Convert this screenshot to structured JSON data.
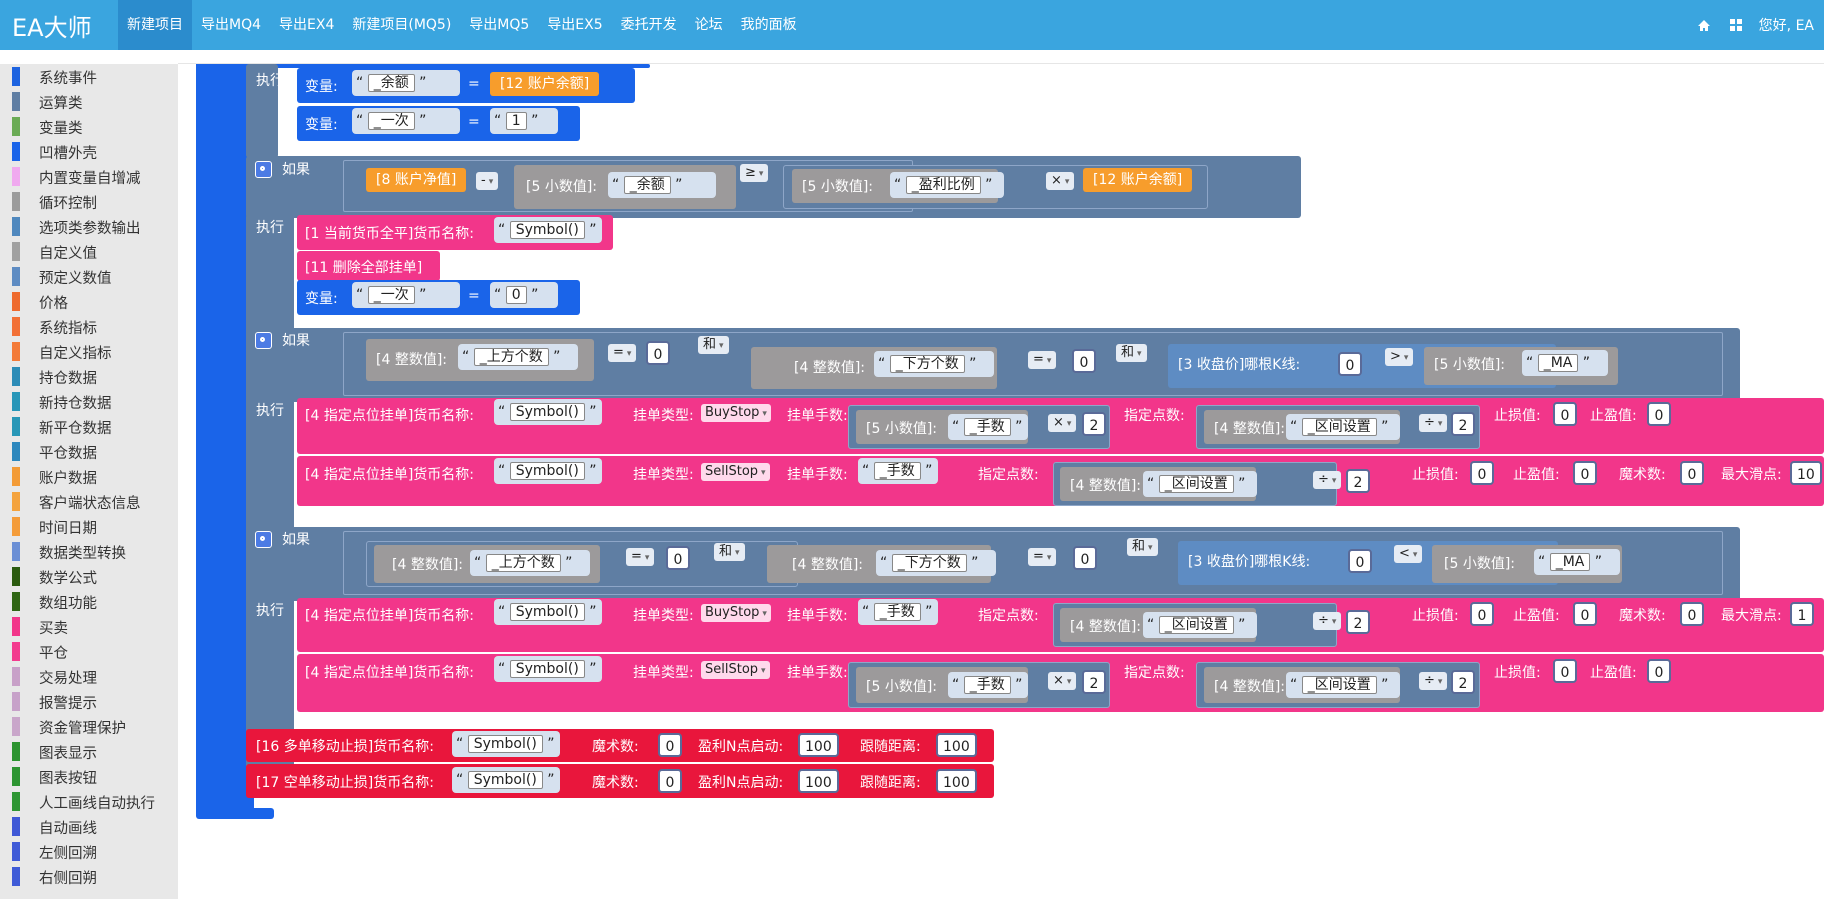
{
  "header": {
    "brand": "EA大师",
    "nav": [
      {
        "label": "新建项目",
        "active": true
      },
      {
        "label": "导出MQ4"
      },
      {
        "label": "导出EX4"
      },
      {
        "label": "新建项目(MQ5)"
      },
      {
        "label": "导出MQ5"
      },
      {
        "label": "导出EX5"
      },
      {
        "label": "委托开发"
      },
      {
        "label": "论坛"
      },
      {
        "label": "我的面板"
      }
    ],
    "greeting": "您好, EA"
  },
  "sidebar": {
    "categories": [
      {
        "label": "系统事件",
        "color": "#1d63e0"
      },
      {
        "label": "运算类",
        "color": "#5f7ea3"
      },
      {
        "label": "变量类",
        "color": "#6aab55"
      },
      {
        "label": "凹槽外壳",
        "color": "#1a64e9"
      },
      {
        "label": "内置变量自增减",
        "color": "#f0a9ef"
      },
      {
        "label": "循环控制",
        "color": "#9b9b9b"
      },
      {
        "label": "选项类参数输出",
        "color": "#4f88be"
      },
      {
        "label": "自定义值",
        "color": "#a0a0a0"
      },
      {
        "label": "预定义数值",
        "color": "#5e8cc3"
      },
      {
        "label": "价格",
        "color": "#ee6a2e"
      },
      {
        "label": "系统指标",
        "color": "#f27036"
      },
      {
        "label": "自定义指标",
        "color": "#f37a38"
      },
      {
        "label": "持仓数据",
        "color": "#2c8cb7"
      },
      {
        "label": "新持仓数据",
        "color": "#2796b8"
      },
      {
        "label": "新平仓数据",
        "color": "#2897b7"
      },
      {
        "label": "平仓数据",
        "color": "#2c87bd"
      },
      {
        "label": "账户数据",
        "color": "#f39b36"
      },
      {
        "label": "客户端状态信息",
        "color": "#f4a33e"
      },
      {
        "label": "时间日期",
        "color": "#f49c3a"
      },
      {
        "label": "数据类型转换",
        "color": "#6b8fd5"
      },
      {
        "label": "数学公式",
        "color": "#2b5b0f"
      },
      {
        "label": "数组功能",
        "color": "#2f6614"
      },
      {
        "label": "买卖",
        "color": "#f2368a"
      },
      {
        "label": "平仓",
        "color": "#f33b8e"
      },
      {
        "label": "交易处理",
        "color": "#c8a0c8"
      },
      {
        "label": "报警提示",
        "color": "#c7a1c9"
      },
      {
        "label": "资金管理保护",
        "color": "#c9a6ca"
      },
      {
        "label": "图表显示",
        "color": "#2c9430"
      },
      {
        "label": "图表按钮",
        "color": "#2d9532"
      },
      {
        "label": "人工画线自动执行",
        "color": "#2e9633"
      },
      {
        "label": "自动画线",
        "color": "#3f58d6"
      },
      {
        "label": "左侧回溯",
        "color": "#3f5ad7"
      },
      {
        "label": "右侧回朔",
        "color": "#3f5bd7"
      }
    ]
  },
  "colors": {
    "outer": "#1a64e9",
    "if": "#5f7ea3",
    "var": "#1a64e9",
    "pending": "#f2368a",
    "trailing": "#e9163c",
    "orange": "#f79d2c",
    "calcgrey": "#9c9a9b",
    "kline": "#5e8cc3"
  },
  "blocks": {
    "kw_exec": "执行",
    "kw_if": "如果",
    "var_label": "变量:",
    "eq": "=",
    "var_balance": "_余额",
    "var_once": "_一次",
    "acct_balance": "[12 账户余额]",
    "acct_equity": "[8 账户净值]",
    "val_1": "1",
    "val_0": "0",
    "val_2": "2",
    "val_100": "100",
    "small_num": "[5 小数值]:",
    "int_num": "[4 整数值]:",
    "kline_close": "[3 收盘价]哪根K线:",
    "var_profit_ratio": "_盈利比例",
    "var_up_count": "_上方个数",
    "var_down_count": "_下方个数",
    "var_ma": "_MA",
    "var_lots": "_手数",
    "var_range": "_区间设置",
    "symbol": "Symbol()",
    "op_minus": "-",
    "op_ge": "≥",
    "op_mul": "×",
    "op_eq": "=",
    "op_gt": ">",
    "op_lt": "<",
    "op_div": "÷",
    "and": "和",
    "close_all": "[1 当前货币全平]货币名称:",
    "delete_pending": "[11 删除全部挂单]",
    "pending_order": "[4 指定点位挂单]货币名称:",
    "order_type": "挂单类型:",
    "buystop": "BuyStop",
    "sellstop": "SellStop",
    "order_lots": "挂单手数:",
    "points": "指定点数:",
    "sl": "止损值:",
    "tp": "止盈值:",
    "magic": "魔术数:",
    "slippage": "最大滑点:",
    "slippage_val": "10",
    "slippage_val2": "1",
    "trail_long": "[16 多单移动止损]货币名称:",
    "trail_short": "[17 空单移动止损]货币名称:",
    "trail_magic": "魔术数:",
    "trail_start": "盈利N点启动:",
    "trail_dist": "跟随距离:"
  }
}
